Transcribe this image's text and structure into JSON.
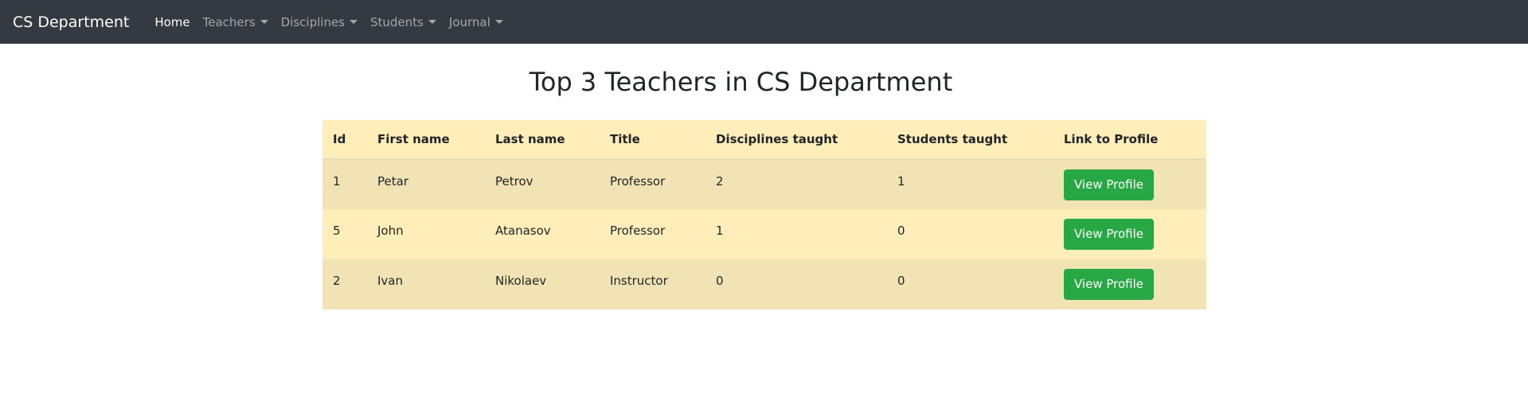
{
  "navbar": {
    "brand": "CS Department",
    "items": [
      {
        "label": "Home",
        "active": true,
        "dropdown": false
      },
      {
        "label": "Teachers",
        "active": false,
        "dropdown": true
      },
      {
        "label": "Disciplines",
        "active": false,
        "dropdown": true
      },
      {
        "label": "Students",
        "active": false,
        "dropdown": true
      },
      {
        "label": "Journal",
        "active": false,
        "dropdown": true
      }
    ]
  },
  "page": {
    "title": "Top 3 Teachers in CS Department"
  },
  "table": {
    "headers": [
      "Id",
      "First name",
      "Last name",
      "Title",
      "Disciplines taught",
      "Students taught",
      "Link to Profile"
    ],
    "rows": [
      {
        "id": "1",
        "first_name": "Petar",
        "last_name": "Petrov",
        "title": "Professor",
        "disciplines": "2",
        "students": "1",
        "button": "View Profile"
      },
      {
        "id": "5",
        "first_name": "John",
        "last_name": "Atanasov",
        "title": "Professor",
        "disciplines": "1",
        "students": "0",
        "button": "View Profile"
      },
      {
        "id": "2",
        "first_name": "Ivan",
        "last_name": "Nikolaev",
        "title": "Instructor",
        "disciplines": "0",
        "students": "0",
        "button": "View Profile"
      }
    ]
  },
  "colors": {
    "navbar_bg": "#343a40",
    "table_header_bg": "#ffeeba",
    "row_odd_bg": "#f2e3b4",
    "row_even_bg": "#ffeeba",
    "button_bg": "#28a745"
  }
}
